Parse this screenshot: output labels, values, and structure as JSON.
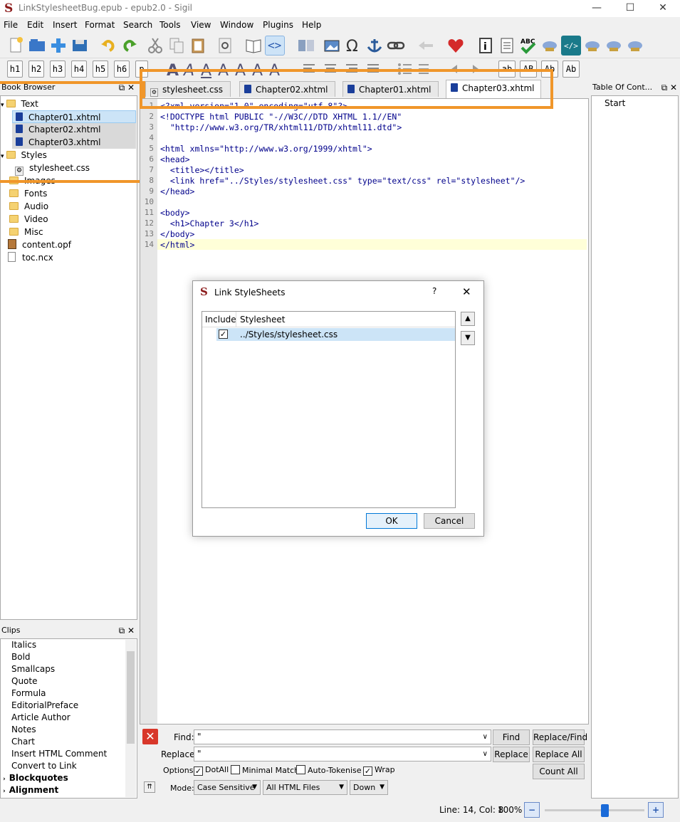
{
  "window": {
    "title": "LinkStylesheetBug.epub - epub2.0 - Sigil",
    "logo": "S",
    "controls": [
      "—",
      "☐",
      "✕"
    ]
  },
  "menu": [
    "File",
    "Edit",
    "Insert",
    "Format",
    "Search",
    "Tools",
    "View",
    "Window",
    "Plugins",
    "Help"
  ],
  "heading_buttons": [
    "h1",
    "h2",
    "h3",
    "h4",
    "h5",
    "h6",
    "p"
  ],
  "case_buttons": [
    "ab",
    "AB",
    "Ab",
    "Ab"
  ],
  "book_browser": {
    "title": "Book Browser",
    "items": [
      {
        "label": "Text",
        "type": "folder"
      },
      {
        "label": "Chapter01.xhtml",
        "type": "xhtml"
      },
      {
        "label": "Chapter02.xhtml",
        "type": "xhtml"
      },
      {
        "label": "Chapter03.xhtml",
        "type": "xhtml"
      },
      {
        "label": "Styles",
        "type": "folder"
      },
      {
        "label": "stylesheet.css",
        "type": "css"
      },
      {
        "label": "Images",
        "type": "folder"
      },
      {
        "label": "Fonts",
        "type": "folder"
      },
      {
        "label": "Audio",
        "type": "folder"
      },
      {
        "label": "Video",
        "type": "folder"
      },
      {
        "label": "Misc",
        "type": "folder"
      },
      {
        "label": "content.opf",
        "type": "opf"
      },
      {
        "label": "toc.ncx",
        "type": "ncx"
      }
    ]
  },
  "tabs": [
    {
      "label": "stylesheet.css"
    },
    {
      "label": "Chapter02.xhtml"
    },
    {
      "label": "Chapter01.xhtml"
    },
    {
      "label": "Chapter03.xhtml",
      "active": true
    }
  ],
  "code_lines": [
    "<?xml version=\"1.0\" encoding=\"utf-8\"?>",
    "<!DOCTYPE html PUBLIC \"-//W3C//DTD XHTML 1.1//EN\"",
    "  \"http://www.w3.org/TR/xhtml11/DTD/xhtml11.dtd\">",
    "",
    "<html xmlns=\"http://www.w3.org/1999/xhtml\">",
    "<head>",
    "  <title></title>",
    "  <link href=\"../Styles/stylesheet.css\" type=\"text/css\" rel=\"stylesheet\"/>",
    "</head>",
    "",
    "<body>",
    "  <h1>Chapter 3</h1>",
    "</body>",
    "</html>"
  ],
  "line_numbers": [
    "1",
    "2",
    "3",
    "4",
    "5",
    "6",
    "7",
    "8",
    "9",
    "10",
    "11",
    "12",
    "13",
    "14"
  ],
  "toc": {
    "title": "Table Of Cont...",
    "items": [
      "Start"
    ]
  },
  "clips": {
    "title": "Clips",
    "items": [
      "Italics",
      "Bold",
      "Smallcaps",
      "Quote",
      "Formula",
      "EditorialPreface",
      "Article Author",
      "Notes",
      "Chart",
      "Insert HTML Comment",
      "Convert to Link",
      "Blockquotes",
      "Alignment"
    ]
  },
  "dialog": {
    "title": "Link StyleSheets",
    "help": "?",
    "close": "✕",
    "col_include": "Include",
    "col_stylesheet": "Stylesheet",
    "rows": [
      {
        "checked": "✓",
        "path": "../Styles/stylesheet.css"
      }
    ],
    "ok": "OK",
    "cancel": "Cancel",
    "up": "▲",
    "down": "▼"
  },
  "find": {
    "find_label": "Find:",
    "find_value": "\"",
    "replace_label": "Replace:",
    "replace_value": "\"",
    "btn_find": "Find",
    "btn_replace_find": "Replace/Find",
    "btn_replace": "Replace",
    "btn_replace_all": "Replace All",
    "btn_count_all": "Count All",
    "options_label": "Options:",
    "dotall": "DotAll",
    "minimal": "Minimal Match",
    "autotok": "Auto-Tokenise",
    "wrap": "Wrap",
    "mode_label": "Mode:",
    "mode": "Case Sensitive",
    "scope": "All HTML Files",
    "direction": "Down"
  },
  "status": {
    "position": "Line: 14, Col: 8",
    "zoom": "100%",
    "zoom_level": 0.6
  }
}
